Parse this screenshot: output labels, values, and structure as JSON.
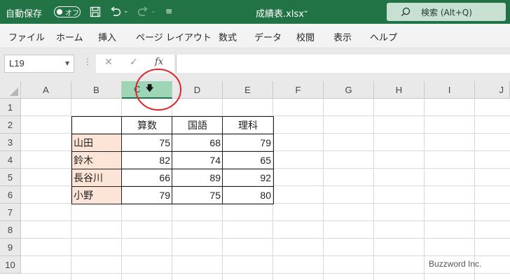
{
  "titlebar": {
    "autosave_label": "自動保存",
    "autosave_state": "オフ",
    "filename": "成績表.xlsx",
    "search_placeholder": "検索 (Alt+Q)"
  },
  "ribbon_tabs": [
    "ファイル",
    "ホーム",
    "挿入",
    "ページ レイアウト",
    "数式",
    "データ",
    "校閲",
    "表示",
    "ヘルプ"
  ],
  "formula_bar": {
    "name_box": "L19",
    "fx": "fx",
    "content": ""
  },
  "columns": [
    "A",
    "B",
    "C",
    "D",
    "E",
    "F",
    "G",
    "H",
    "I",
    "J"
  ],
  "selected_column": "C",
  "rows": [
    "1",
    "2",
    "3",
    "4",
    "5",
    "6",
    "7",
    "8",
    "9",
    "10"
  ],
  "table": {
    "headers": [
      "算数",
      "国語",
      "理科"
    ],
    "names": [
      "山田",
      "鈴木",
      "長谷川",
      "小野"
    ],
    "values": [
      [
        "75",
        "68",
        "79"
      ],
      [
        "82",
        "74",
        "65"
      ],
      [
        "66",
        "89",
        "92"
      ],
      [
        "79",
        "75",
        "80"
      ]
    ]
  },
  "watermark": "Buzzword Inc.",
  "colors": {
    "titlebar": "#217346",
    "selected_header": "#9fd5b7",
    "name_fill": "#fce4d6",
    "highlight_circle": "#e0232b"
  }
}
